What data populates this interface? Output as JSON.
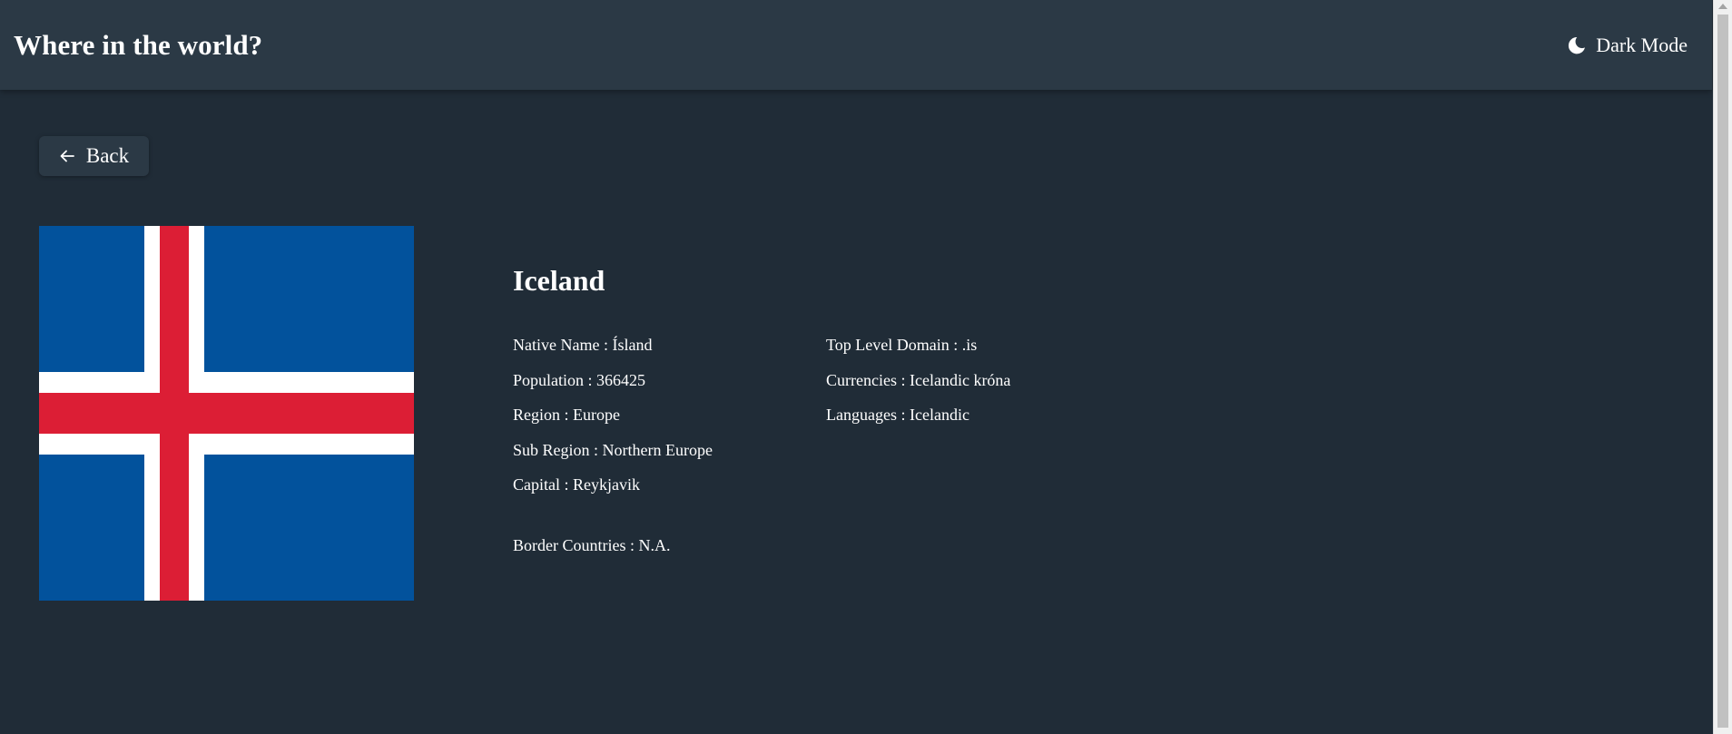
{
  "header": {
    "title": "Where in the world?",
    "mode_label": "Dark Mode",
    "mode_icon": "moon-icon"
  },
  "back_button": {
    "label": "Back",
    "icon": "arrow-left-icon"
  },
  "country": {
    "name": "Iceland",
    "flag_colors": {
      "field": "#02529c",
      "cross_outer": "#ffffff",
      "cross_inner": "#dc1e35"
    },
    "left_details": [
      {
        "label": "Native Name",
        "value": "Ísland"
      },
      {
        "label": "Population",
        "value": "366425"
      },
      {
        "label": "Region",
        "value": "Europe"
      },
      {
        "label": "Sub Region",
        "value": "Northern Europe"
      },
      {
        "label": "Capital",
        "value": "Reykjavik"
      }
    ],
    "right_details": [
      {
        "label": "Top Level Domain",
        "value": ".is"
      },
      {
        "label": "Currencies",
        "value": "Icelandic króna"
      },
      {
        "label": "Languages",
        "value": "Icelandic"
      }
    ],
    "border_countries": {
      "label": "Border Countries",
      "value": "N.A."
    }
  },
  "colors": {
    "background": "#202c37",
    "elements": "#2b3945",
    "text": "#ffffff"
  }
}
